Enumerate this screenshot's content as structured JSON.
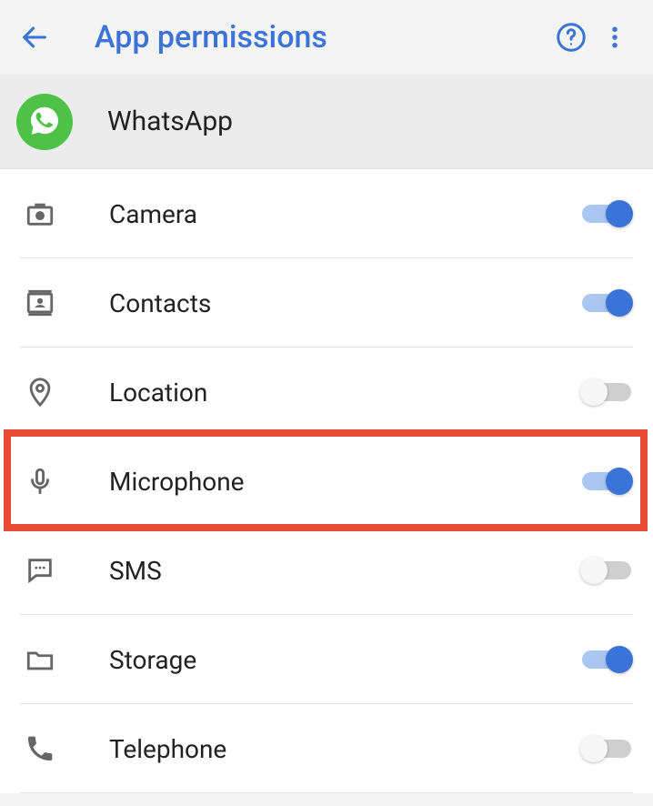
{
  "toolbar": {
    "title": "App permissions"
  },
  "app": {
    "name": "WhatsApp"
  },
  "permissions": [
    {
      "key": "camera",
      "label": "Camera",
      "icon": "camera-icon",
      "enabled": true,
      "highlighted": false
    },
    {
      "key": "contacts",
      "label": "Contacts",
      "icon": "contacts-icon",
      "enabled": true,
      "highlighted": false
    },
    {
      "key": "location",
      "label": "Location",
      "icon": "location-icon",
      "enabled": false,
      "highlighted": false
    },
    {
      "key": "microphone",
      "label": "Microphone",
      "icon": "microphone-icon",
      "enabled": true,
      "highlighted": true
    },
    {
      "key": "sms",
      "label": "SMS",
      "icon": "sms-icon",
      "enabled": false,
      "highlighted": false
    },
    {
      "key": "storage",
      "label": "Storage",
      "icon": "storage-icon",
      "enabled": true,
      "highlighted": false
    },
    {
      "key": "telephone",
      "label": "Telephone",
      "icon": "phone-icon",
      "enabled": false,
      "highlighted": false
    }
  ],
  "colors": {
    "accent": "#3b73d6",
    "highlight": "#e94b35",
    "whatsapp": "#4dc247"
  }
}
